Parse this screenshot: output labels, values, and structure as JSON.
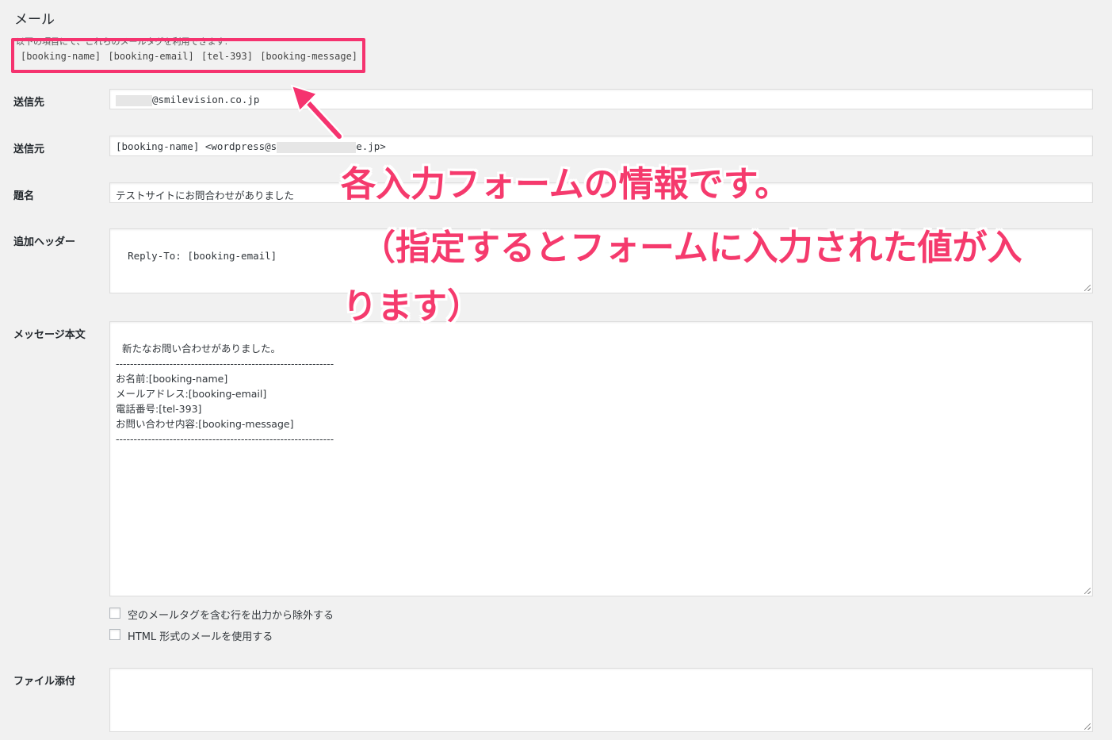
{
  "section": {
    "title": "メール",
    "hint": "以下の項目にて、これらのメールタグを利用できます:",
    "mail_tags": "[booking-name] [booking-email] [tel-393] [booking-message]"
  },
  "fields": {
    "to": {
      "label": "送信先",
      "value_suffix": "@smilevision.co.jp"
    },
    "from": {
      "label": "送信元",
      "value_prefix": "[booking-name] <wordpress@s",
      "value_suffix": "e.jp>"
    },
    "subject": {
      "label": "題名",
      "value": "テストサイトにお問合わせがありました"
    },
    "headers": {
      "label": "追加ヘッダー",
      "value": "Reply-To: [booking-email]"
    },
    "body": {
      "label": "メッセージ本文",
      "value": "新たなお問い合わせがありました。\n-------------------------------------------------------------\nお名前:[booking-name]\nメールアドレス:[booking-email]\n電話番号:[tel-393]\nお問い合わせ内容:[booking-message]\n-------------------------------------------------------------"
    },
    "attachments": {
      "label": "ファイル添付",
      "value": ""
    }
  },
  "options": {
    "exclude_blank": {
      "label": "空のメールタグを含む行を出力から除外する",
      "checked": false
    },
    "use_html": {
      "label": "HTML 形式のメールを使用する",
      "checked": false
    }
  },
  "annotation": {
    "line1": "各入力フォームの情報です。",
    "line2": "（指定するとフォームに入力された値が入",
    "line3": "ります）",
    "color": "#f53a6d"
  }
}
